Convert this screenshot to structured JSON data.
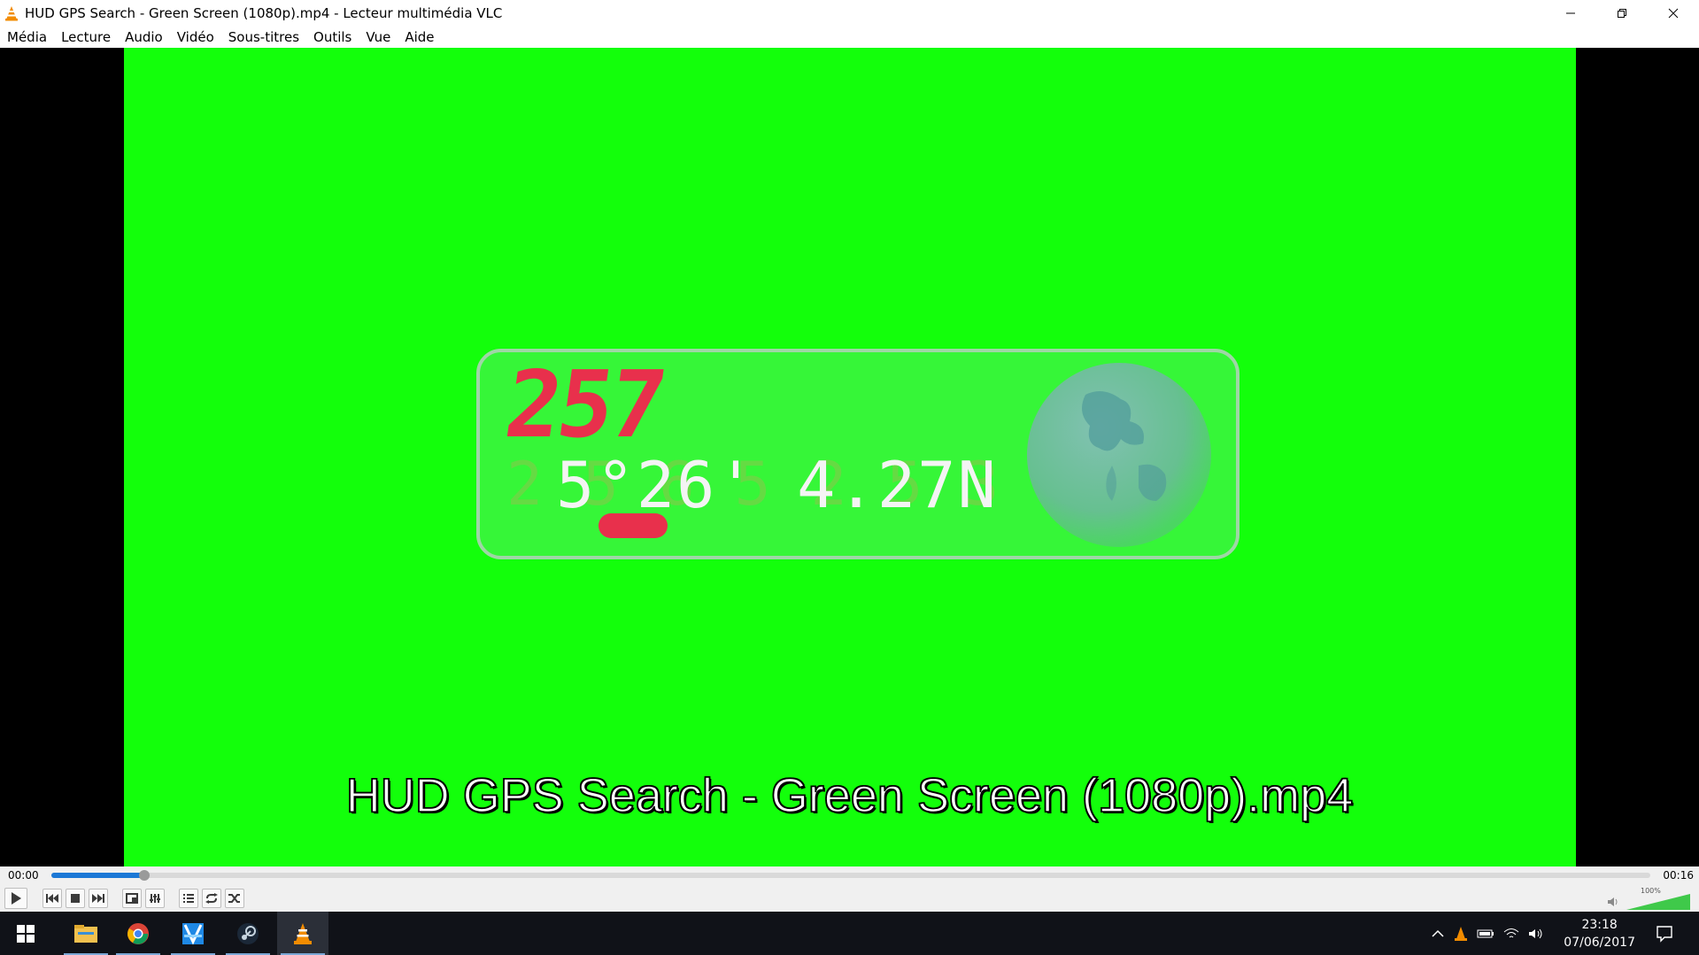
{
  "window": {
    "title": "HUD GPS Search - Green Screen (1080p).mp4 - Lecteur multimédia VLC",
    "icon": "vlc-cone-icon"
  },
  "menu": [
    "Média",
    "Lecture",
    "Audio",
    "Vidéo",
    "Sous-titres",
    "Outils",
    "Vue",
    "Aide"
  ],
  "video": {
    "background_color": "#13ff0b",
    "hud": {
      "big_number": "257",
      "coordinates": "5°26' 4.27N",
      "ghost_text": "2 5 6 5 2 5 3"
    },
    "subtitle": "HUD GPS Search - Green Screen (1080p).mp4"
  },
  "player": {
    "elapsed": "00:00",
    "duration": "00:16",
    "progress": 0.058,
    "volume_label": "100%",
    "volume_level": 1.0,
    "buttons": [
      "play-icon",
      "previous-icon",
      "stop-icon",
      "next-icon",
      "fullscreen-icon",
      "extended-settings-icon",
      "playlist-icon",
      "loop-icon",
      "shuffle-icon"
    ]
  },
  "taskbar": {
    "apps": [
      "windows-start-icon",
      "file-explorer-icon",
      "chrome-icon",
      "video-editor-icon",
      "steam-icon",
      "vlc-icon"
    ],
    "tray_icons": [
      "chevron-up-icon",
      "vlc-tray-icon",
      "battery-icon",
      "wifi-icon",
      "speaker-icon"
    ],
    "time": "23:18",
    "date": "07/06/2017"
  },
  "colors": {
    "accent": "#1c78d6",
    "hud_red": "#e8304c",
    "taskbar": "#101218"
  }
}
